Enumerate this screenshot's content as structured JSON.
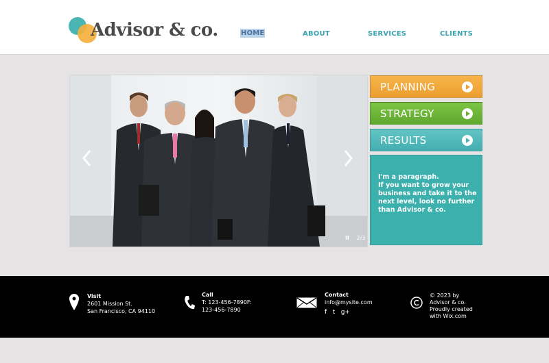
{
  "header": {
    "logo_text": "Advisor & co.",
    "nav": {
      "home": "HOME",
      "about": "ABOUT",
      "services": "SERVICES",
      "clients": "CLIENTS"
    }
  },
  "slider": {
    "counter": "2/3",
    "pause_symbol": "II"
  },
  "side_buttons": {
    "planning": "PLANNING",
    "strategy": "STRATEGY",
    "results": "RESULTS"
  },
  "info_box": {
    "line1": "I'm a paragraph.",
    "line2": "If you want to grow your business and take it to the next level, look no further than Advisor & co."
  },
  "footer": {
    "visit": {
      "title": "Visit",
      "line1": "2601 Mission St.",
      "line2": "San Francisco, CA 94110"
    },
    "call": {
      "title": "Call",
      "line1": "T: 123-456-7890F:",
      "line2": "123-456-7890"
    },
    "contact": {
      "title": "Contact",
      "email": "info@mysite.com",
      "social": [
        "f",
        "t",
        "g+"
      ]
    },
    "copyright": {
      "line1": "© 2023 by",
      "line2": "Advisor & co.",
      "line3": "Proudly created",
      "line4": "with Wix.com"
    }
  },
  "colors": {
    "teal": "#3bb0ad",
    "orange": "#f4b13e",
    "green": "#6db23a",
    "nav_text": "#3ea3b0"
  }
}
